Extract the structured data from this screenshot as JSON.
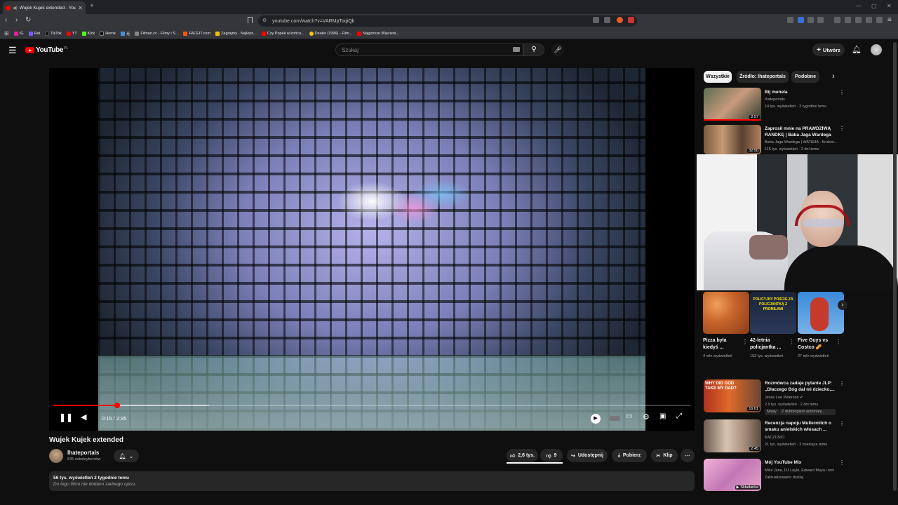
{
  "browser": {
    "tab_title": "Wujek Kujek extended - YouTube",
    "url": "youtube.com/watch?v=VARMpToqiQk",
    "bookmarks": [
      "IG",
      "Rat",
      "TikTok",
      "YT",
      "Kick",
      "Home",
      "光",
      "Filman.cc - Filmy i S...",
      "FACEIT.com",
      "Zagrajmy - Najleps...",
      "Czy Popek w końcu...",
      "Dealer (1996) - Film...",
      "Najgorsze Więzieni..."
    ]
  },
  "header": {
    "logo_text": "YouTube",
    "logo_country": "PL",
    "search_placeholder": "Szukaj",
    "create_label": "Utwórz"
  },
  "player": {
    "time": "0:15 / 2:35",
    "progress_fraction": 0.1
  },
  "video": {
    "title": "Wujek Kujek extended",
    "channel": "Ihateportals",
    "subscribers": "535 subskrybentów",
    "likes": "2,6 tys.",
    "dislikes": "9",
    "share_label": "Udostępnij",
    "download_label": "Pobierz",
    "clip_label": "Klip",
    "views_date": "56 tys. wyświetleń  2 tygodnie temu",
    "description": "Do tego filmu nie dodano żadnego opisu."
  },
  "sidebar": {
    "chips": [
      "Wszystkie",
      "Źródło: Ihateportals",
      "Podobne"
    ],
    "top_items": [
      {
        "title": "Bij menela",
        "channel": "Ihateportals",
        "meta": "14 tys. wyświetleń · 2 tygodnie temu",
        "duration": "2:57"
      },
      {
        "title": "Zaprosił mnie na PRAWDZIWĄ RANDKĘ | Baba Jaga Wardega",
        "channel": "Baba Jaga Wardega | WATAHA - Krulest...",
        "meta": "115 tys. wyświetleń · 2 dni temu",
        "duration": "32:50"
      }
    ],
    "shorts": [
      {
        "title": "Pizza była kiedyś ...",
        "views": "4 mln wyświetleń"
      },
      {
        "title": "42-letnia policjantka ...",
        "views": "192 tys. wyświetleń"
      },
      {
        "title": "Five Guys vs Costco 🥜",
        "views": "27 mln wyświetleń"
      }
    ],
    "shorts_overlay_text": "POLICYJNY POŚCIG ZA POLICJANTKĄ Z PROMILAMI",
    "bottom_items": [
      {
        "title": "Rozmówca zadaje pytanie JLP: „Dlaczego Bóg dał mi dziecko,...",
        "channel": "Jesse Lee Peterson",
        "meta": "2,9 tys. wyświetleń · 2 dni temu",
        "badge1": "Nowy",
        "badge2": "Z dubbingiem automaty...",
        "duration": "16:01",
        "thumb_text": "WHY DID GOD TAKE MY DAD?"
      },
      {
        "title": "Recenzja napoju Mullermilch o smaku anielskich włosach ...",
        "channel": "KACZUSIO",
        "meta": "21 tys. wyświetleń · 2 miesiące temu",
        "duration": "2:45"
      },
      {
        "title": "Mój YouTube Mix",
        "channel": "Miss Jane, DJ Layla, Edward Maya i inni",
        "meta": "Zaktualizowano dzisiaj",
        "duration": "Składanka"
      }
    ]
  }
}
